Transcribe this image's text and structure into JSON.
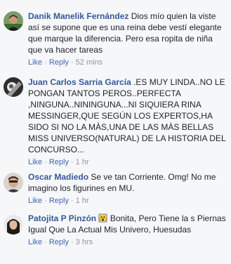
{
  "comments": [
    {
      "author": "Danik Manelik Fernández",
      "text": "Dios mío quien la viste así se supone que es una reina debe vestí elegante que marque la diferencia. Pero esa ropita de niña que va hacer tareas",
      "like": "Like",
      "reply": "Reply",
      "time": "52 mins"
    },
    {
      "author": "Juan Carlos Sarria García",
      "text": ".ES MUY LINDA..NO LE PONGAN TANTOS PEROS..PERFECTA ,NINGUNA..NININGUNA...NI SIQUIERA RINA MESSINGER,QUE SEGÚN LOS EXPERTOS,HA SIDO SI NO LA MÀS,UNA DE LAS MÀS BELLAS MISS UNIVERSO(NATURAL) DE LA HISTORIA DEL CONCURSO...",
      "like": "Like",
      "reply": "Reply",
      "time": "1 hr"
    },
    {
      "author": "Oscar Madiedo",
      "text": "Se ve tan Corriente. Omg! No me imagino los figurines en MU.",
      "like": "Like",
      "reply": "Reply",
      "time": "1 hr"
    },
    {
      "author": "Patojita P Pinzón",
      "emoji": "scream-emoji-icon",
      "text": "Bonita, Pero Tiene la s Piernas Igual Que La Actual Mis Univero, Huesudas",
      "like": "Like",
      "reply": "Reply",
      "time": "3 hrs"
    }
  ],
  "colors": {
    "author": "#365899",
    "link": "#4267b2",
    "meta": "#90949c",
    "text": "#1d2129",
    "background": "#f6f7f9"
  }
}
